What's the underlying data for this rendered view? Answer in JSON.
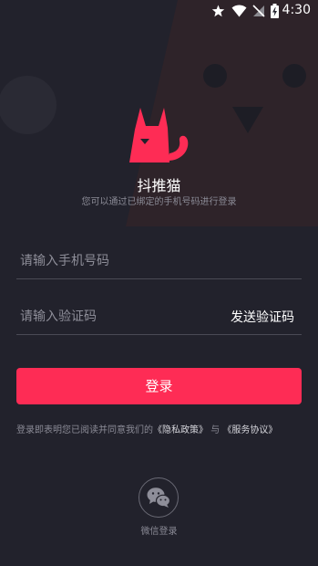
{
  "status_bar": {
    "time": "4:30",
    "icons": [
      "star-icon",
      "wifi-icon",
      "signal-icon",
      "battery-charging-icon"
    ]
  },
  "app": {
    "name": "抖推猫",
    "subtitle": "您可以通过已绑定的手机号码进行登录",
    "logo_icon": "cat-logo-icon"
  },
  "form": {
    "phone_placeholder": "请输入手机号码",
    "phone_value": "",
    "code_placeholder": "请输入验证码",
    "code_value": "",
    "send_code_label": "发送验证码",
    "login_label": "登录"
  },
  "agreement": {
    "prefix": "登录即表明您已阅读并同意我们的",
    "privacy_link": "《隐私政策》",
    "conjunction": "与",
    "service_link": "《服务协议》"
  },
  "wechat": {
    "label": "微信登录",
    "icon": "wechat-icon"
  },
  "colors": {
    "background": "#22222c",
    "accent": "#fe2c55",
    "muted_text": "#8b8b96"
  }
}
